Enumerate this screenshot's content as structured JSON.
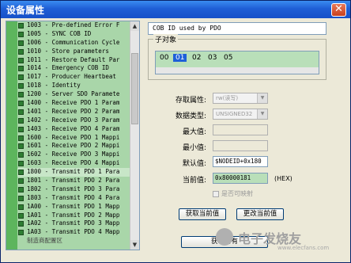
{
  "window": {
    "title": "设备属性"
  },
  "tree": {
    "items": [
      "1003 - Pre-defined Error F",
      "1005 - SYNC COB ID",
      "1006 - Communication Cycle",
      "1010 - Store parameters",
      "1011 - Restore Default Par",
      "1014 - Emergency COB ID",
      "1017 - Producer Heartbeat",
      "1018 - Identity",
      "1200 - Server SDO Paramete",
      "1400 - Receive PDO 1 Param",
      "1401 - Receive PDO 2 Param",
      "1402 - Receive PDO 3 Param",
      "1403 - Receive PDO 4 Param",
      "1600 - Receive PDO 1 Mappi",
      "1601 - Receive PDO 2 Mappi",
      "1602 - Receive PDO 3 Mappi",
      "1603 - Receive PDO 4 Mappi",
      "1800 - Transmit PDO 1 Para",
      "1801 - Transmit PDO 2 Para",
      "1802 - Transmit PDO 3 Para",
      "1803 - Transmit PDO 4 Para",
      "1A00 - Transmit PDO 1 Mapp",
      "1A01 - Transmit PDO 2 Mapp",
      "1A02 - Transmit PDO 3 Mapp",
      "1A03 - Transmit PDO 4 Mapp"
    ],
    "footer": "制造商配置区",
    "selected_index": 17
  },
  "object_desc": "COB ID used by PDO",
  "subindex": {
    "label": "子对象",
    "items": [
      "00",
      "01",
      "02",
      "03",
      "05"
    ],
    "selected": "01"
  },
  "fields": {
    "access_label": "存取属性:",
    "access_value": "rw(读写)",
    "datatype_label": "数据类型:",
    "datatype_value": "UNSIGNED32",
    "max_label": "最大值:",
    "min_label": "最小值:",
    "default_label": "默认值:",
    "default_value": "$NODEID+0x180",
    "current_label": "当前值:",
    "current_value": "0x80000181",
    "hex_label": "(HEX)",
    "mappable_label": "是否可映射"
  },
  "buttons": {
    "get_current": "获取当前值",
    "change_current": "更改当前值",
    "get_all": "获取所有"
  },
  "watermark": {
    "text": "电子发烧友",
    "url": "www.elecfans.com"
  }
}
